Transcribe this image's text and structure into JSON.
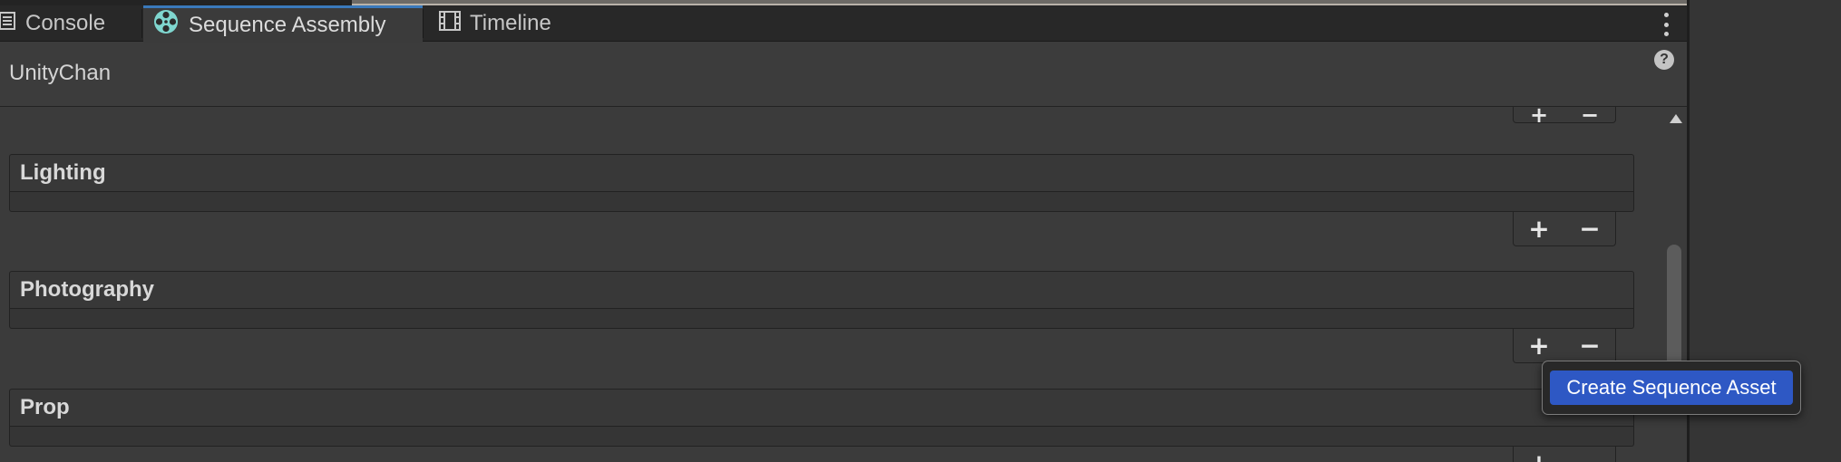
{
  "tabs": [
    {
      "label": "Console",
      "icon": "console-icon"
    },
    {
      "label": "Sequence Assembly",
      "icon": "film-reel-icon"
    },
    {
      "label": "Timeline",
      "icon": "timeline-icon"
    }
  ],
  "header": {
    "asset_name": "UnityChan",
    "help_symbol": "?"
  },
  "groups": [
    {
      "title": "Lighting"
    },
    {
      "title": "Photography"
    },
    {
      "title": "Prop"
    }
  ],
  "controls": {
    "add": "+",
    "remove": "−"
  },
  "popup": {
    "button_label": "Create Sequence Asset"
  },
  "colors": {
    "accent": "#2e58c4",
    "active_tab_line": "#3a79bb",
    "reel_icon": "#7fd6cf"
  }
}
